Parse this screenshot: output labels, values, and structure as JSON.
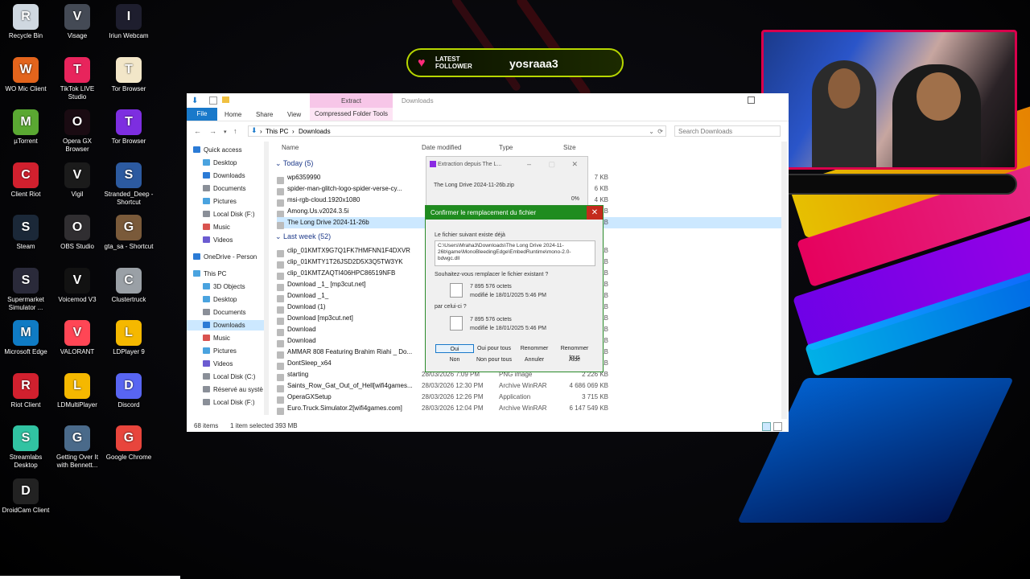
{
  "desktop_icons": [
    {
      "label": "Recycle Bin",
      "icon": "recycle-bin-icon",
      "color": "#cfd8e0"
    },
    {
      "label": "Visage",
      "icon": "visage-icon",
      "color": "#444a55"
    },
    {
      "label": "Iriun Webcam",
      "icon": "webcam-icon",
      "color": "#1e1e2e"
    },
    {
      "label": "WO Mic Client",
      "icon": "mic-icon",
      "color": "#e3641c"
    },
    {
      "label": "TikTok LIVE Studio",
      "icon": "tiktok-icon",
      "color": "#e8245c"
    },
    {
      "label": "Tor Browser",
      "icon": "tor-icon",
      "color": "#f2e6c8"
    },
    {
      "label": "µTorrent",
      "icon": "utorrent-icon",
      "color": "#5aa832"
    },
    {
      "label": "Opera GX Browser",
      "icon": "opera-gx-icon",
      "color": "#1a0b12"
    },
    {
      "label": "Tor Browser",
      "icon": "tor-purple-icon",
      "color": "#7d2ee0"
    },
    {
      "label": "Client Riot",
      "icon": "riot-icon",
      "color": "#d1202e"
    },
    {
      "label": "Vigil",
      "icon": "vigil-icon",
      "color": "#1b1b1b"
    },
    {
      "label": "Stranded_Deep - Shortcut",
      "icon": "stranded-deep-icon",
      "color": "#2c5aa0"
    },
    {
      "label": "Steam",
      "icon": "steam-icon",
      "color": "#1b2838"
    },
    {
      "label": "OBS Studio",
      "icon": "obs-icon",
      "color": "#302e31"
    },
    {
      "label": "gta_sa - Shortcut",
      "icon": "gta-icon",
      "color": "#7a5a3a"
    },
    {
      "label": "Supermarket Simulator ...",
      "icon": "supermarket-icon",
      "color": "#2a2a3a"
    },
    {
      "label": "Voicemod V3",
      "icon": "voicemod-icon",
      "color": "#121212"
    },
    {
      "label": "Clustertruck",
      "icon": "clustertruck-icon",
      "color": "#9aa0a6"
    },
    {
      "label": "Microsoft Edge",
      "icon": "edge-icon",
      "color": "#0f7bc4"
    },
    {
      "label": "VALORANT",
      "icon": "valorant-icon",
      "color": "#ff4655"
    },
    {
      "label": "LDPlayer 9",
      "icon": "ldplayer-icon",
      "color": "#f5b800"
    },
    {
      "label": "Riot Client",
      "icon": "riot-client-icon",
      "color": "#d1202e"
    },
    {
      "label": "LDMultiPlayer",
      "icon": "ldmultiplayer-icon",
      "color": "#f5b800"
    },
    {
      "label": "Discord",
      "icon": "discord-icon",
      "color": "#5865f2"
    },
    {
      "label": "Streamlabs Desktop",
      "icon": "streamlabs-icon",
      "color": "#31c3a2"
    },
    {
      "label": "Getting Over It with Bennett...",
      "icon": "getting-over-it-icon",
      "color": "#4a6a8a"
    },
    {
      "label": "Google Chrome",
      "icon": "chrome-icon",
      "color": "#e8453c"
    },
    {
      "label": "DroidCam Client",
      "icon": "droidcam-icon",
      "color": "#222"
    }
  ],
  "follower": {
    "label_line1": "LATEST",
    "label_line2": "FOLLOWER",
    "name": "yosraaa3"
  },
  "explorer": {
    "ribbon": {
      "file": "File",
      "home": "Home",
      "share": "Share",
      "view": "View",
      "extract": "Extract",
      "compressed_tools": "Compressed Folder Tools"
    },
    "window_title": "Downloads",
    "address": {
      "this_pc": "This PC",
      "downloads": "Downloads"
    },
    "search_placeholder": "Search Downloads",
    "nav": [
      {
        "label": "Quick access",
        "icon": "star-icon",
        "color": "#2b7bd6"
      },
      {
        "label": "Desktop",
        "icon": "desktop-icon",
        "color": "#4aa3df"
      },
      {
        "label": "Downloads",
        "icon": "downloads-icon",
        "color": "#2b7bd6"
      },
      {
        "label": "Documents",
        "icon": "documents-icon",
        "color": "#8a8f98"
      },
      {
        "label": "Pictures",
        "icon": "pictures-icon",
        "color": "#4aa3df"
      },
      {
        "label": "Local Disk (F:)",
        "icon": "disk-icon",
        "color": "#8a8f98"
      },
      {
        "label": "Music",
        "icon": "music-icon",
        "color": "#d9534f"
      },
      {
        "label": "Videos",
        "icon": "videos-icon",
        "color": "#6b5bd1"
      },
      {
        "label": "OneDrive - Person",
        "icon": "onedrive-icon",
        "color": "#2b7bd6"
      },
      {
        "label": "This PC",
        "icon": "this-pc-icon",
        "color": "#4aa3df"
      },
      {
        "label": "3D Objects",
        "icon": "3d-objects-icon",
        "color": "#4aa3df"
      },
      {
        "label": "Desktop",
        "icon": "desktop-icon",
        "color": "#4aa3df"
      },
      {
        "label": "Documents",
        "icon": "documents-icon",
        "color": "#8a8f98"
      },
      {
        "label": "Downloads",
        "icon": "downloads-icon",
        "color": "#2b7bd6"
      },
      {
        "label": "Music",
        "icon": "music-icon",
        "color": "#d9534f"
      },
      {
        "label": "Pictures",
        "icon": "pictures-icon",
        "color": "#4aa3df"
      },
      {
        "label": "Videos",
        "icon": "videos-icon",
        "color": "#6b5bd1"
      },
      {
        "label": "Local Disk (C:)",
        "icon": "disk-icon",
        "color": "#8a8f98"
      },
      {
        "label": "Réservé au systè",
        "icon": "disk-icon",
        "color": "#8a8f98"
      },
      {
        "label": "Local Disk (F:)",
        "icon": "disk-icon",
        "color": "#8a8f98"
      }
    ],
    "columns": {
      "name": "Name",
      "date": "Date modified",
      "type": "Type",
      "size": "Size"
    },
    "groups": {
      "today": "Today (5)",
      "last_week": "Last week (52)"
    },
    "today_files": [
      {
        "name": "wp6359990",
        "date": "",
        "type": "",
        "size": "7 KB"
      },
      {
        "name": "spider-man-glitch-logo-spider-verse-cy...",
        "date": "",
        "type": "",
        "size": "6 KB"
      },
      {
        "name": "msi-rgb-cloud.1920x1080",
        "date": "",
        "type": "",
        "size": "4 KB"
      },
      {
        "name": "Among.Us.v2024.3.5i",
        "date": "",
        "type": "",
        "size": "0 KB"
      },
      {
        "name": "The Long Drive 2024-11-26b",
        "date": "",
        "type": "",
        "size": "4 KB"
      }
    ],
    "week_files": [
      {
        "name": "clip_01KMTX9G7Q1FK7HMFNN1F4DXVR",
        "date": "",
        "type": "",
        "size": "2 KB"
      },
      {
        "name": "clip_01KMTY1T26JSD2D5X3Q5TW3YK",
        "date": "",
        "type": "",
        "size": "2 KB"
      },
      {
        "name": "clip_01KMTZAQTI406HPC86519NFB",
        "date": "",
        "type": "",
        "size": "2 KB"
      },
      {
        "name": "Download _1_ [mp3cut.net]",
        "date": "",
        "type": "",
        "size": "0 KB"
      },
      {
        "name": "Download _1_",
        "date": "",
        "type": "",
        "size": "0 KB"
      },
      {
        "name": "Download (1)",
        "date": "",
        "type": "",
        "size": "0 KB"
      },
      {
        "name": "Download [mp3cut.net]",
        "date": "",
        "type": "",
        "size": "0 KB"
      },
      {
        "name": "Download",
        "date": "",
        "type": "",
        "size": "0 KB"
      },
      {
        "name": "Download",
        "date": "",
        "type": "",
        "size": "0 KB"
      },
      {
        "name": "AMMAR 808 Featuring Brahim Riahi _ Do...",
        "date": "",
        "type": "",
        "size": "0 KB"
      },
      {
        "name": "DontSleep_x64",
        "date": "",
        "type": "",
        "size": "3 KB"
      },
      {
        "name": "starting",
        "date": "28/03/2026 7:09 PM",
        "type": "PNG image",
        "size": "2 226 KB"
      },
      {
        "name": "Saints_Row_Gat_Out_of_Hell[wifi4games...",
        "date": "28/03/2026 12:30 PM",
        "type": "Archive WinRAR",
        "size": "4 686 069 KB"
      },
      {
        "name": "OperaGXSetup",
        "date": "28/03/2026 12:26 PM",
        "type": "Application",
        "size": "3 715 KB"
      },
      {
        "name": "Euro.Truck.Simulator.2[wifi4games.com]",
        "date": "28/03/2026 12:04 PM",
        "type": "Archive WinRAR",
        "size": "6 147 549 KB"
      }
    ],
    "status": {
      "items": "68 items",
      "selected": "1 item selected 393 MB"
    }
  },
  "extract_dialog": {
    "title": "Extraction depuis The L...",
    "file": "The Long Drive 2024-11-26b.zip",
    "percent": "0%"
  },
  "confirm_dialog": {
    "title": "Confirmer le remplacement du fichier",
    "exists_label": "Le fichier suivant existe déjà",
    "path": "C:\\Users\\Mraha3\\Downloads\\The Long Drive 2024-11-26b\\game\\MonoBleedingEdge\\EmbedRuntime\\mono-2.0-bdwgc.dll",
    "question": "Souhaitez-vous remplacer le fichier existant ?",
    "existing_size": "7 895 576 octets",
    "existing_date": "modifié le 18/01/2025 5:46 PM",
    "by_label": "par celui-ci ?",
    "new_size": "7 895 576 octets",
    "new_date": "modifié le 18/01/2025 5:46 PM",
    "buttons": {
      "yes": "Oui",
      "yes_all": "Oui pour tous",
      "rename": "Renommer",
      "rename_all": "Renommer tous",
      "no": "Non",
      "no_all": "Non pour tous",
      "cancel": "Annuler",
      "help": "Aide"
    }
  }
}
